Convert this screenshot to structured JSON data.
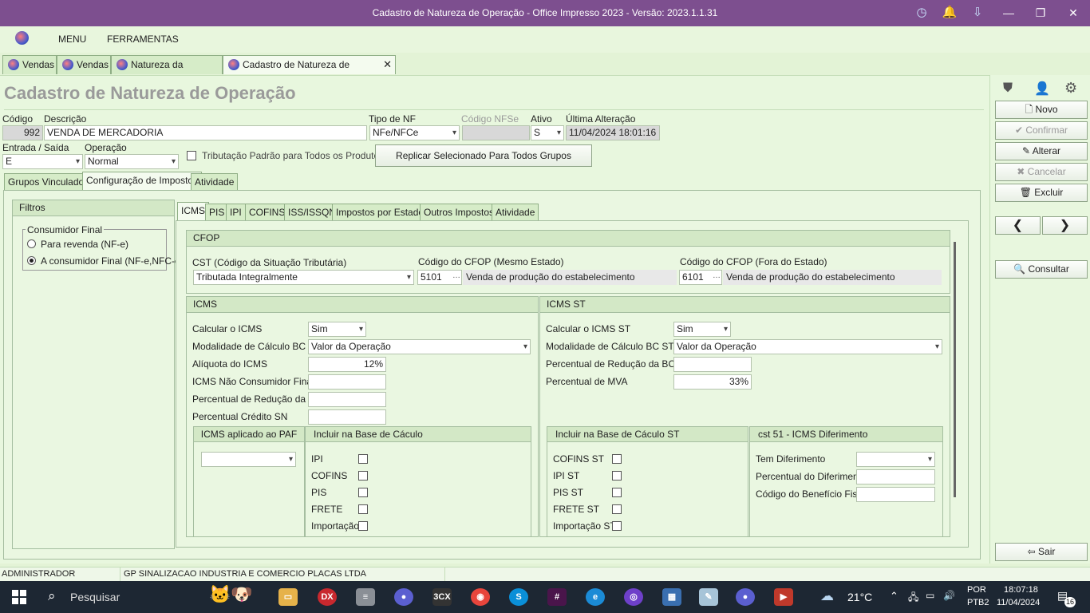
{
  "window": {
    "title": "Cadastro de Natureza de Operação - Office Impresso 2023 - Versão: 2023.1.1.31"
  },
  "menu": {
    "items": [
      "MENU",
      "FERRAMENTAS"
    ]
  },
  "doc_tabs": [
    "Vendas",
    "Vendas",
    "Natureza da Operação",
    "Cadastro de Natureza de Operação"
  ],
  "page_title": "Cadastro de Natureza de Operação",
  "form": {
    "codigo_label": "Código",
    "codigo": "992",
    "descricao_label": "Descrição",
    "descricao": "VENDA DE MERCADORIA",
    "tipo_nf_label": "Tipo de NF",
    "tipo_nf": "NFe/NFCe",
    "codigo_nfse_label": "Código NFSe",
    "codigo_nfse": "",
    "ativo_label": "Ativo",
    "ativo": "S",
    "ultima_alteracao_label": "Última Alteração",
    "ultima_alteracao": "11/04/2024 18:01:16",
    "entrada_saida_label": "Entrada / Saída",
    "entrada_saida": "E",
    "operacao_label": "Operação",
    "operacao": "Normal",
    "tributacao_padrao_label": "Tributação Padrão para Todos os Produtos",
    "replicar_button": "Replicar Selecionado Para Todos Grupos"
  },
  "section_tabs": [
    "Grupos Vinculados",
    "Configuração de Impostos",
    "Atividade"
  ],
  "filtros": {
    "title": "Filtros",
    "group_title": "Consumidor Final",
    "options": [
      "Para revenda (NF-e)",
      "A consumidor Final (NF-e,NFC-e)"
    ],
    "selected": 1
  },
  "tax_tabs": [
    "ICMS",
    "PIS",
    "IPI",
    "COFINS",
    "ISS/ISSQN",
    "Impostos por Estado",
    "Outros Impostos",
    "Atividade"
  ],
  "cfop": {
    "title": "CFOP",
    "cst_label": "CST (Código da Situação Tributária)",
    "cst": "Tributada Integralmente",
    "mesmo_estado_label": "Código do CFOP (Mesmo Estado)",
    "mesmo_estado_code": "5101",
    "mesmo_estado_desc": "Venda de produção do estabelecimento",
    "fora_estado_label": "Código do CFOP (Fora do Estado)",
    "fora_estado_code": "6101",
    "fora_estado_desc": "Venda de produção do estabelecimento"
  },
  "icms": {
    "title": "ICMS",
    "calcular_label": "Calcular o ICMS",
    "calcular": "Sim",
    "modalidade_label": "Modalidade de Cálculo BC",
    "modalidade": "Valor da Operação",
    "aliquota_label": "Alíquota do ICMS",
    "aliquota": "12%",
    "nao_consumidor_label": "ICMS Não Consumidor Final",
    "nao_consumidor": "",
    "reducao_label": "Percentual de Redução da BC",
    "reducao": "",
    "credito_sn_label": "Percentual Crédito SN",
    "credito_sn": "",
    "paf_title": "ICMS aplicado ao PAF",
    "paf": "",
    "base_title": "Incluir na Base de Cáculo",
    "base_items": [
      "IPI",
      "COFINS",
      "PIS",
      "FRETE",
      "Importação"
    ]
  },
  "icms_st": {
    "title": "ICMS ST",
    "calcular_label": "Calcular o ICMS ST",
    "calcular": "Sim",
    "modalidade_label": "Modalidade de Cálculo BC ST",
    "modalidade": "Valor da Operação",
    "reducao_label": "Percentual de Redução da BC ST",
    "reducao": "",
    "mva_label": "Percentual de MVA",
    "mva": "33%",
    "base_title": "Incluir na Base de Cáculo ST",
    "base_items": [
      "COFINS ST",
      "IPI ST",
      "PIS ST",
      "FRETE ST",
      "Importação ST"
    ],
    "diferimento_title": "cst 51 - ICMS Diferimento",
    "tem_diferimento_label": "Tem Diferimento",
    "tem_diferimento": "",
    "perc_diferimento_label": "Percentual do Diferimento",
    "perc_diferimento": "",
    "beneficio_label": "Código do Benefício Fiscal",
    "beneficio": ""
  },
  "side_buttons": {
    "novo": "Novo",
    "confirmar": "Confirmar",
    "alterar": "Alterar",
    "cancelar": "Cancelar",
    "excluir": "Excluir",
    "consultar": "Consultar",
    "sair": "Sair"
  },
  "status": {
    "user": "ADMINISTRADOR",
    "company": "GP SINALIZACAO INDUSTRIA E COMERCIO PLACAS LTDA"
  },
  "taskbar": {
    "search": "Pesquisar",
    "weather": "21°C",
    "lang1": "POR",
    "lang2": "PTB2",
    "time": "18:07:18",
    "date": "11/04/2024",
    "notif": "16"
  }
}
